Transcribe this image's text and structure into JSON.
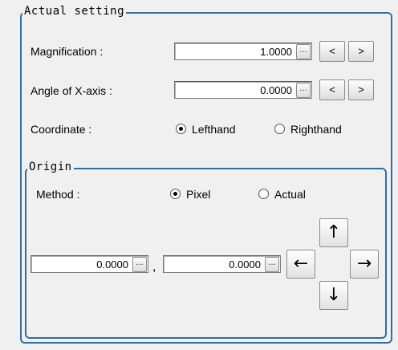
{
  "actual_setting": {
    "legend": "Actual setting",
    "magnification": {
      "label": "Magnification :",
      "value": "1.0000",
      "ellipsis": "...",
      "dec": "<",
      "inc": ">"
    },
    "angle": {
      "label": "Angle of X-axis :",
      "value": "0.0000",
      "ellipsis": "...",
      "dec": "<",
      "inc": ">"
    },
    "coordinate": {
      "label": "Coordinate :",
      "option1": "Lefthand",
      "option2": "Righthand",
      "selected": "Lefthand"
    }
  },
  "origin": {
    "legend": "Origin",
    "method": {
      "label": "Method :",
      "option1": "Pixel",
      "option2": "Actual",
      "selected": "Pixel"
    },
    "x_value": "0.0000",
    "y_value": "0.0000",
    "ellipsis": "...",
    "separator": ",",
    "arrows": {
      "up": "↑",
      "left": "←",
      "right": "→",
      "down": "↓"
    }
  }
}
